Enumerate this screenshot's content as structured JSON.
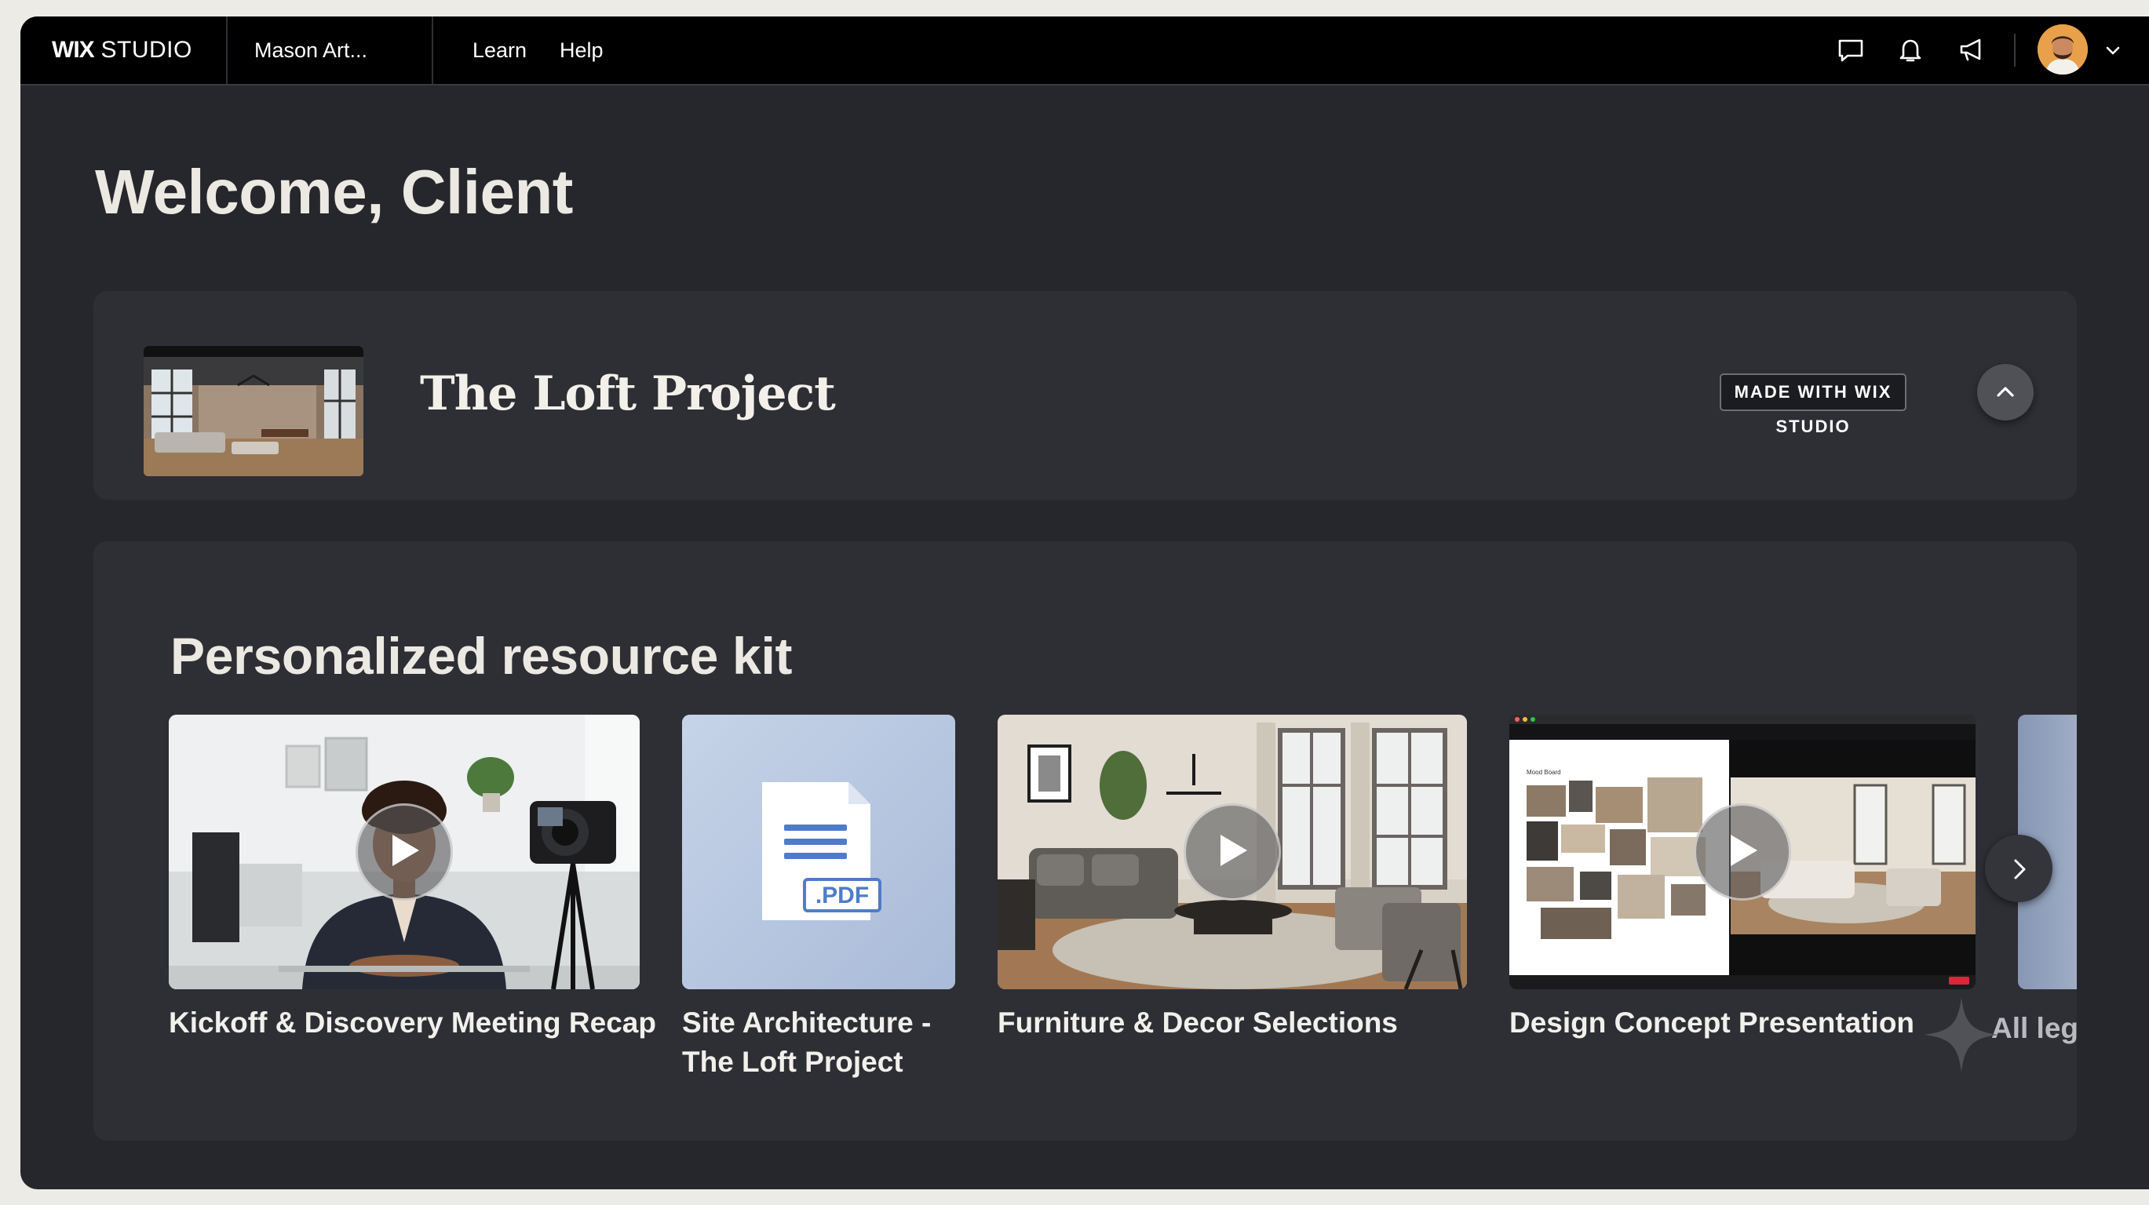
{
  "topbar": {
    "logo_bold": "WIX",
    "logo_rest": " STUDIO",
    "site_name": "Mason Art...",
    "links": [
      "Learn",
      "Help"
    ]
  },
  "welcome": "Welcome, Client",
  "project": {
    "title": "The Loft Project",
    "badge": "MADE WITH WIX STUDIO"
  },
  "kit": {
    "title": "Personalized resource kit",
    "items": [
      {
        "label": "Kickoff & Discovery Meeting Recap",
        "type": "video"
      },
      {
        "label_line1": "Site Architecture -",
        "label_line2": "The Loft Project",
        "type": "pdf",
        "file_ext": ".PDF"
      },
      {
        "label": "Furniture & Decor Selections",
        "type": "video"
      },
      {
        "label": "Design Concept Presentation",
        "type": "video",
        "slide_heading": "Mood Board"
      },
      {
        "label": "All leg",
        "type": "partial"
      }
    ]
  },
  "colors": {
    "background": "#26272c",
    "card": "#2e2f35",
    "topbar": "#000000",
    "text": "#ece9e2"
  },
  "icons": [
    "chat-icon",
    "bell-icon",
    "megaphone-icon",
    "chevron-down-icon",
    "chevron-up-icon",
    "play-icon",
    "chevron-right-icon",
    "sparkle-icon",
    "pdf-icon"
  ]
}
